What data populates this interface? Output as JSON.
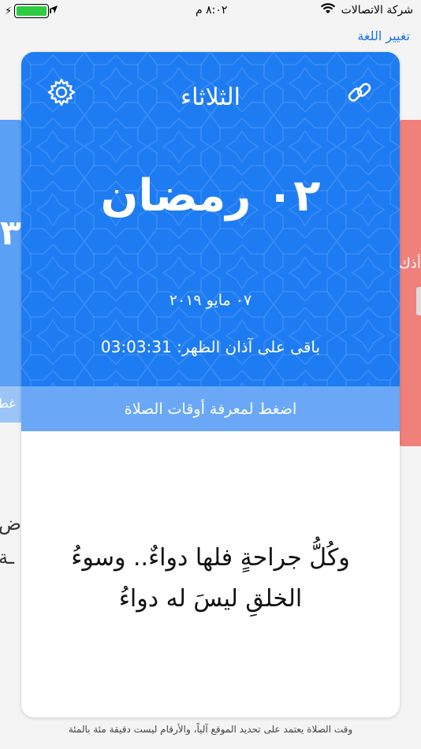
{
  "status_bar": {
    "carrier": "شركة الاتصالات",
    "time": "٨:٠٢ م",
    "icons": [
      "wifi-icon",
      "location-icon",
      "battery-icon",
      "charging-icon"
    ]
  },
  "header": {
    "language_link": "تغيير اللغة"
  },
  "card": {
    "day_name": "الثلاثاء",
    "hijri_date": "٠٢ رمضان",
    "gregorian_date": "٠٧ مايو ٢٠١٩",
    "countdown_label": "باقى على آذان الظهر:",
    "countdown_time": "03:03:31",
    "prayer_times_button": "اضغط لمعرفة أوقات الصلاة",
    "quote_line1": "وكُلُّ جراحةٍ فلها دواءٌ.. وسوءُ",
    "quote_line2": "الخلقِ ليسَ له دواءُ",
    "icons": {
      "settings": "gear-icon",
      "share": "link-icon"
    }
  },
  "side_cards": {
    "left_number": "٣",
    "left_strip_text": "غط",
    "right_text": "أذك",
    "left_peek_a": "ض",
    "left_peek_b": "ـة"
  },
  "footer": {
    "note": "وقت الصلاة يعتمد على تحديد الموقع آلياً، والأرقام ليست دقيقة مئة بالمئة"
  },
  "colors": {
    "card_blue": "#1e7cf2",
    "prayer_bar": "#6aa8f7",
    "left_card": "#5aa0f5",
    "right_card": "#f0807a",
    "link": "#1a73e8"
  }
}
